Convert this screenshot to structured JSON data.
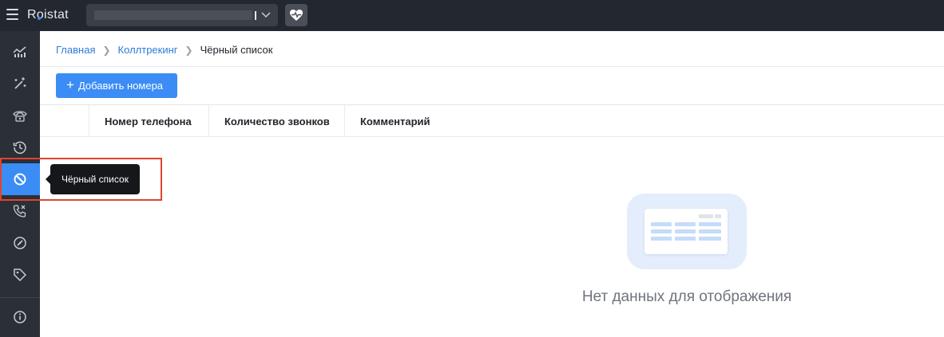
{
  "app": {
    "logo_text": "Roistat",
    "colors": {
      "accent": "#3b8cf5",
      "topbar": "#23272f",
      "sidebar": "#2b2f36",
      "highlight": "#e0442f"
    }
  },
  "topbar": {
    "menu_icon": "hamburger-icon",
    "project_select_value": "",
    "health_icon": "heart-pulse-icon"
  },
  "sidebar": {
    "items": [
      {
        "icon": "analytics-chart-icon",
        "active": false
      },
      {
        "icon": "magic-wand-icon",
        "active": false
      },
      {
        "icon": "phone-calltracking-icon",
        "active": false
      },
      {
        "icon": "history-icon",
        "active": false
      },
      {
        "icon": "ban-icon",
        "active": true
      },
      {
        "icon": "phone-missed-icon",
        "active": false
      },
      {
        "icon": "gauge-icon",
        "active": false
      },
      {
        "icon": "tag-icon",
        "active": false
      },
      {
        "icon": "info-icon",
        "active": false
      }
    ],
    "tooltip": "Чёрный список"
  },
  "breadcrumb": {
    "home": "Главная",
    "section": "Коллтрекинг",
    "current": "Чёрный список"
  },
  "toolbar": {
    "add_button_label": "Добавить номера"
  },
  "table": {
    "columns": [
      "Номер телефона",
      "Количество звонков",
      "Комментарий"
    ],
    "rows": []
  },
  "empty_state": {
    "text": "Нет данных для отображения",
    "icon": "empty-table-illustration"
  }
}
